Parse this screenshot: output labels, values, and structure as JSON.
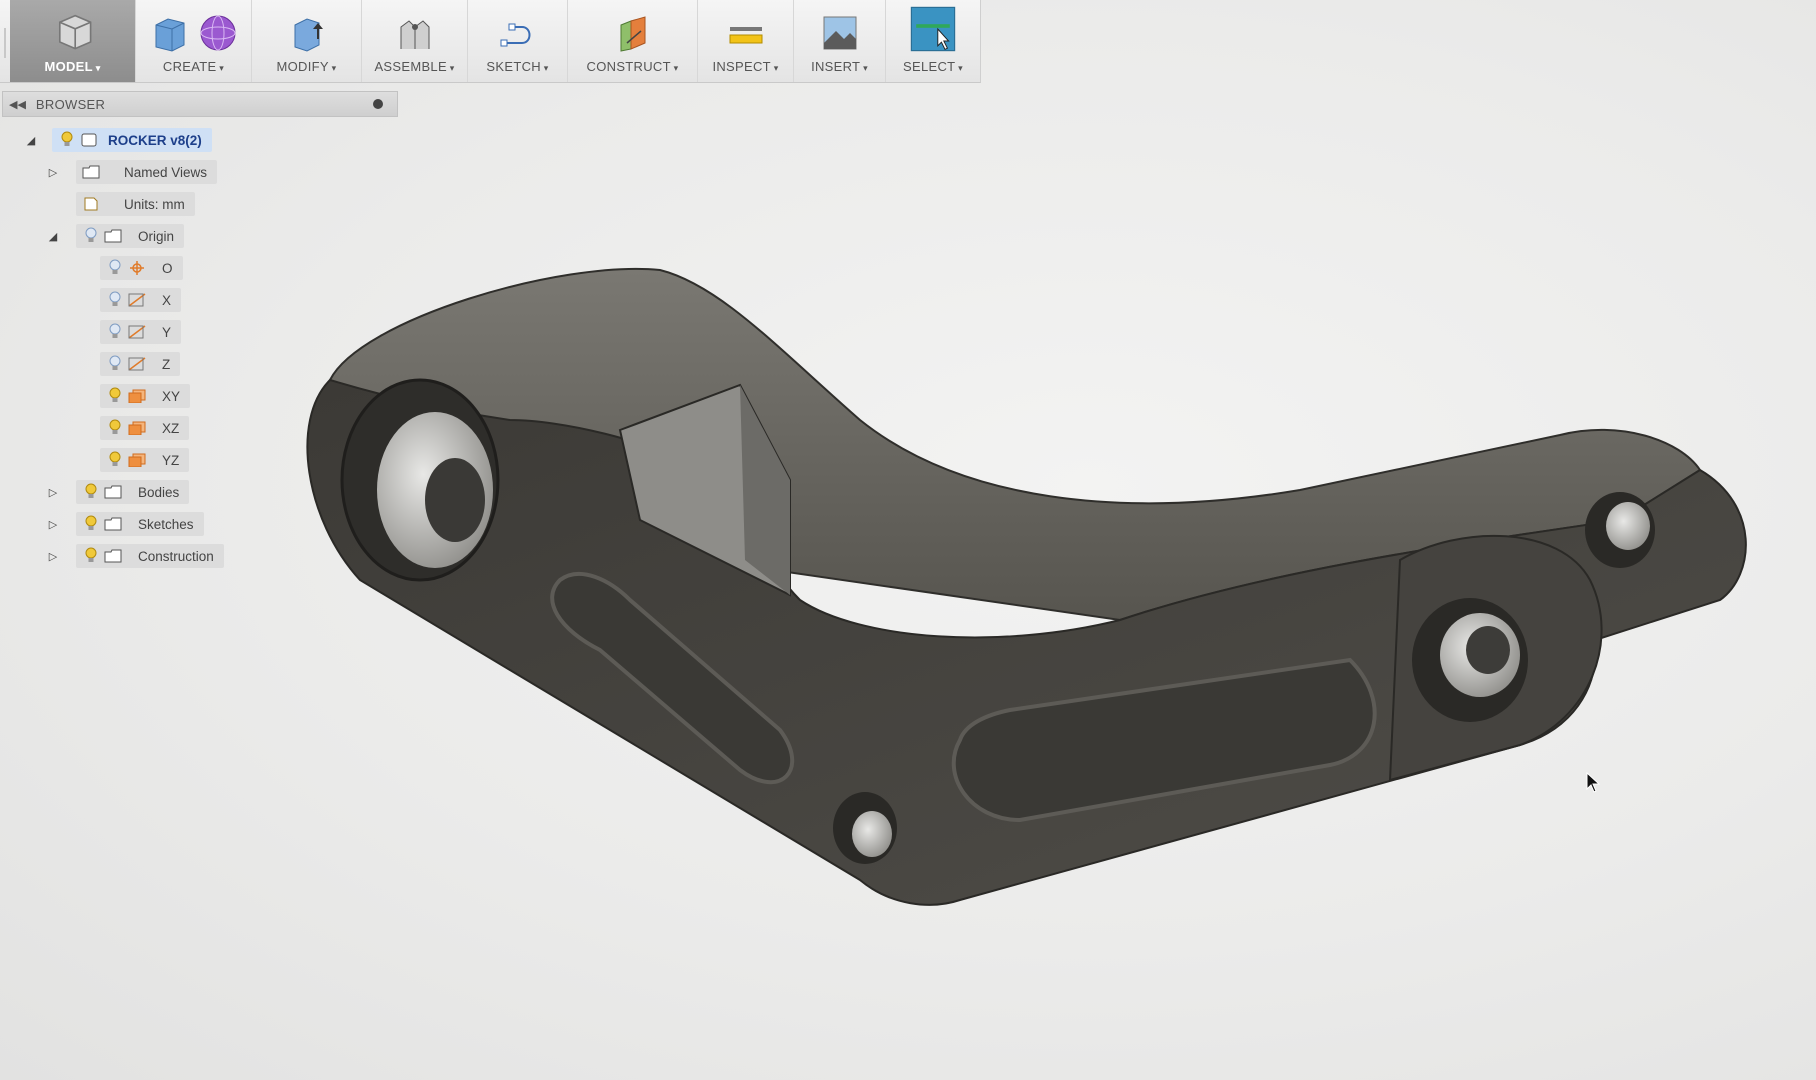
{
  "toolbar": {
    "groups": [
      {
        "name": "model",
        "label": "MODEL"
      },
      {
        "name": "create",
        "label": "CREATE"
      },
      {
        "name": "modify",
        "label": "MODIFY"
      },
      {
        "name": "assemble",
        "label": "ASSEMBLE"
      },
      {
        "name": "sketch",
        "label": "SKETCH"
      },
      {
        "name": "construct",
        "label": "CONSTRUCT"
      },
      {
        "name": "inspect",
        "label": "INSPECT"
      },
      {
        "name": "insert",
        "label": "INSERT"
      },
      {
        "name": "select",
        "label": "SELECT"
      }
    ]
  },
  "browser": {
    "title": "BROWSER",
    "root": {
      "label": "ROCKER v8(2)"
    },
    "items": {
      "named_views": "Named Views",
      "units": "Units: mm",
      "origin": "Origin",
      "origin_o": "O",
      "origin_x": "X",
      "origin_y": "Y",
      "origin_z": "Z",
      "origin_xy": "XY",
      "origin_xz": "XZ",
      "origin_yz": "YZ",
      "bodies": "Bodies",
      "sketches": "Sketches",
      "construction": "Construction"
    }
  },
  "colors": {
    "part_body": "#4a4843",
    "selection_highlight": "#cfe0f5",
    "bulb_on": "#f0c93a",
    "bulb_off": "#a9bfdc"
  }
}
